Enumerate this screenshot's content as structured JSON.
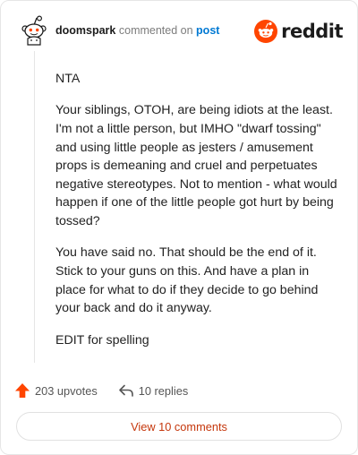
{
  "header": {
    "username": "doomspark",
    "verb": "commented on",
    "post_link": "post",
    "brand": "reddit"
  },
  "comment": {
    "paragraphs": [
      "NTA",
      "Your siblings, OTOH, are being idiots at the least. I'm not a little person, but IMHO \"dwarf tossing\" and using little people as jesters / amusement props is demeaning and cruel and perpetuates negative stereotypes. Not to mention - what would happen if one of the little people got hurt by being tossed?",
      "You have said no. That should be the end of it. Stick to your guns on this. And have a plan in place for what to do if they decide to go behind your back and do it anyway.",
      "EDIT for spelling"
    ]
  },
  "actions": {
    "upvotes": "203 upvotes",
    "replies": "10 replies"
  },
  "view_comments_label": "View 10 comments",
  "colors": {
    "brand_orange": "#ff4500",
    "link_blue": "#0079d3",
    "view_button_text": "#c5370c"
  },
  "icons": {
    "avatar": "snoo-avatar-icon",
    "brand": "reddit-logo-icon",
    "upvote": "upvote-arrow-icon",
    "reply": "reply-arrow-icon"
  }
}
